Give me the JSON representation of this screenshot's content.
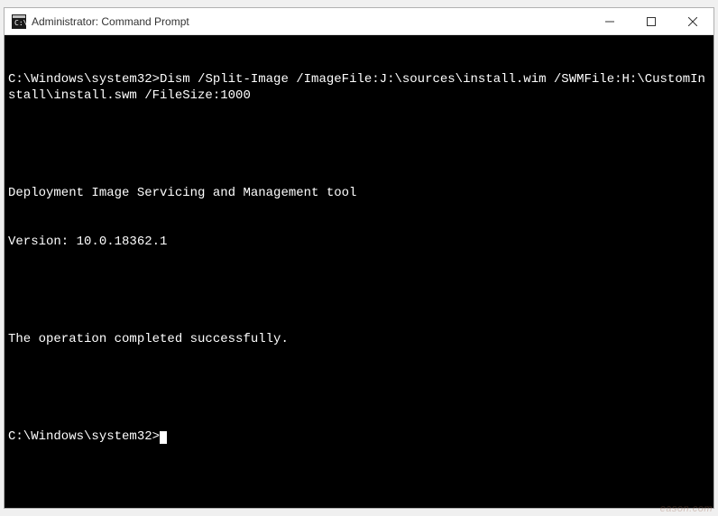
{
  "window": {
    "title": "Administrator: Command Prompt"
  },
  "terminal": {
    "prompt1": "C:\\Windows\\system32>",
    "command": "Dism /Split-Image /ImageFile:J:\\sources\\install.wim /SWMFile:H:\\CustomInstall\\install.swm /FileSize:1000",
    "out1": "Deployment Image Servicing and Management tool",
    "out2": "Version: 10.0.18362.1",
    "out3": "The operation completed successfully.",
    "prompt2": "C:\\Windows\\system32>"
  },
  "watermark": "eason.com"
}
